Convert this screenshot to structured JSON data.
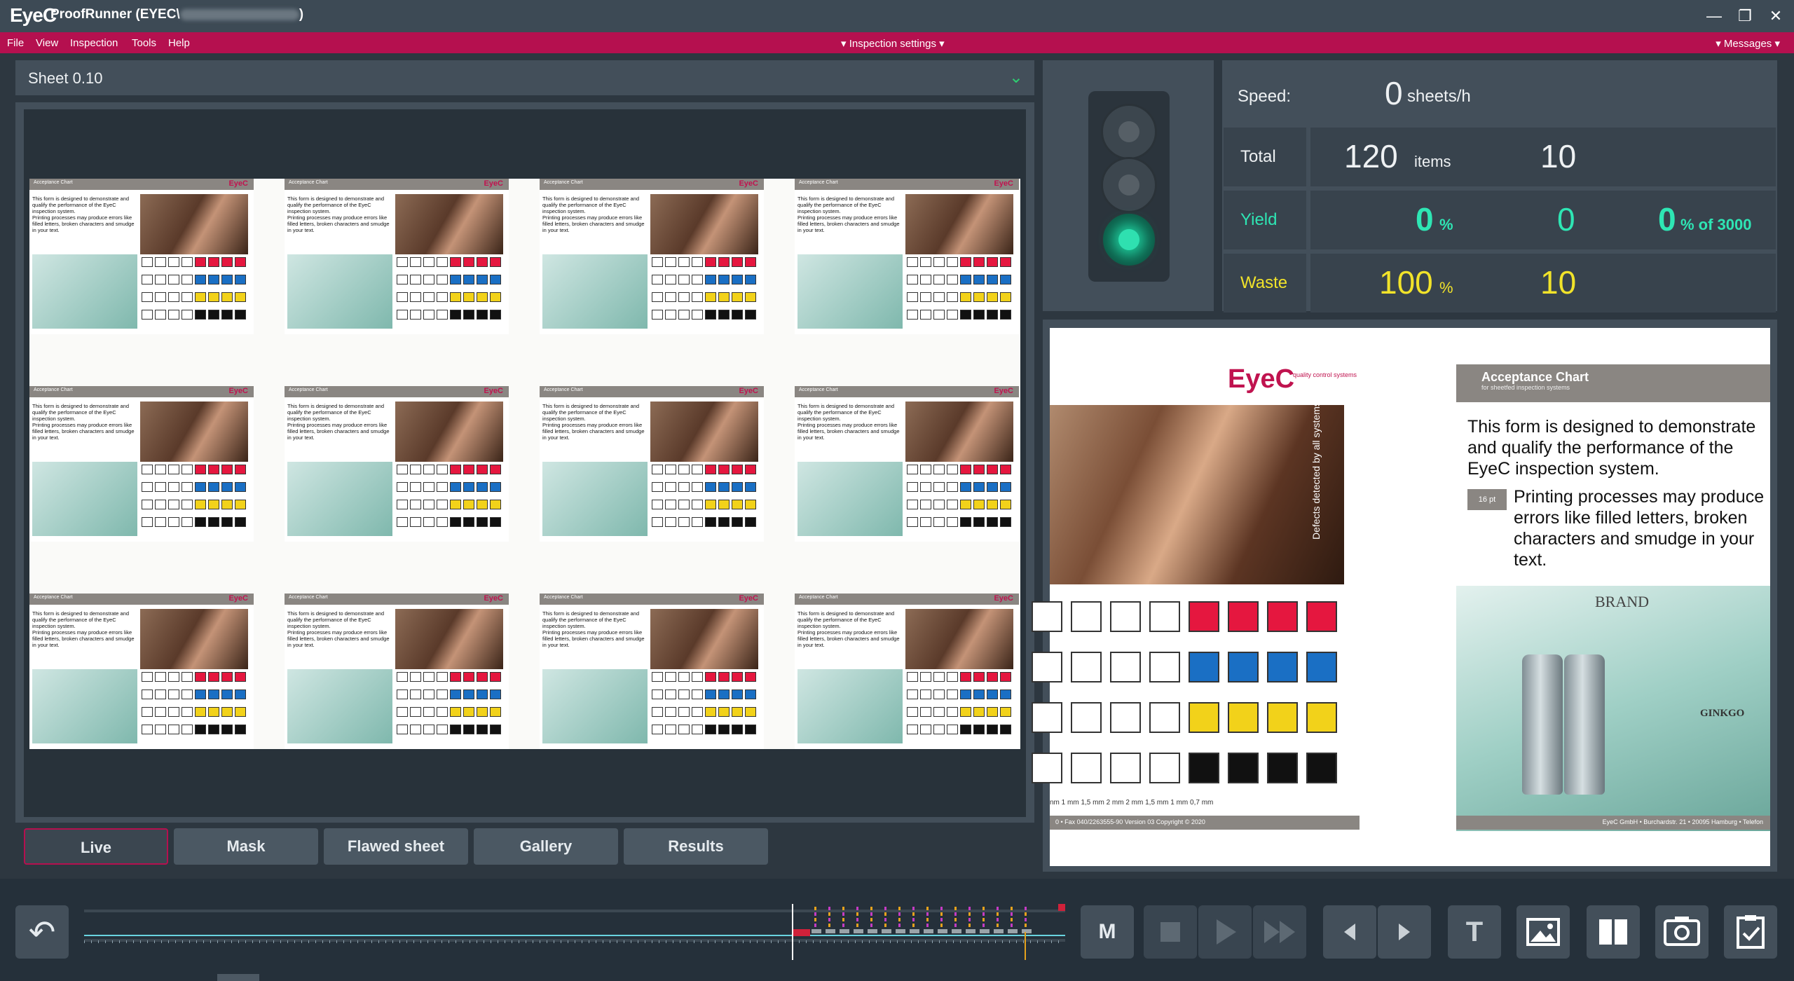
{
  "app": {
    "logo": "EyeC",
    "title_prefix": "ProofRunner  (EYEC\\",
    "title_suffix": ")"
  },
  "menu": {
    "items": [
      "File",
      "View",
      "Inspection",
      "Tools",
      "Help"
    ],
    "center": "▾ Inspection settings ▾",
    "right": "▾ Messages ▾"
  },
  "sheet": {
    "title": "Sheet  0.10"
  },
  "label": {
    "head": "Acceptance Chart",
    "logo": "EyeC",
    "text1": "This form is designed to demonstrate and qualify the performance of the EyeC inspection system.",
    "text2": "Printing processes may produce errors like filled letters, broken characters and smudge in your text.",
    "brand": "BRAND"
  },
  "tabs": [
    "Live",
    "Mask",
    "Flawed sheet",
    "Gallery",
    "Results"
  ],
  "stats": {
    "speed_label": "Speed:",
    "speed_value": "0",
    "speed_unit": "sheets/h",
    "total_label": "Total",
    "total_value": "120",
    "total_unit": "items",
    "total_sheets": "10",
    "yield_label": "Yield",
    "yield_pct": "0",
    "yield_pct_unit": "%",
    "yield_sheets": "0",
    "yield_of": "0",
    "yield_of_unit": "% of 3000",
    "waste_label": "Waste",
    "waste_pct": "100",
    "waste_pct_unit": "%",
    "waste_sheets": "10",
    "color_yield": "#2ee6b4",
    "color_waste": "#f1e32a"
  },
  "traffic_light": {
    "active": "green"
  },
  "preview": {
    "logo": "EyeC",
    "logo_sub": "quality control systems",
    "vertical_text": "Defects detected by all systems",
    "chart_title": "Acceptance Chart",
    "chart_sub": "for sheetfed inspection systems",
    "text1": "This form is designed to demonstrate and qualify the performance of the EyeC inspection system.",
    "tag": "16 pt",
    "text2": "Printing processes may produce errors like filled letters, broken characters and smudge in your text.",
    "brand": "BRAND",
    "ginkgo": "GINKGO",
    "sizes": "nm        1 mm        1,5 mm       2 mm       2 mm        1,5 mm        1 mm        0,7 mm",
    "footer": "0 • Fax 040/2263555-90   Version 03 Copyright © 2020",
    "footer_right": "EyeC GmbH • Burchardstr. 21 • 20095 Hamburg • Telefon"
  },
  "toolbar": {
    "undo_icon": "↶",
    "m_label": "M",
    "t_label": "T"
  }
}
